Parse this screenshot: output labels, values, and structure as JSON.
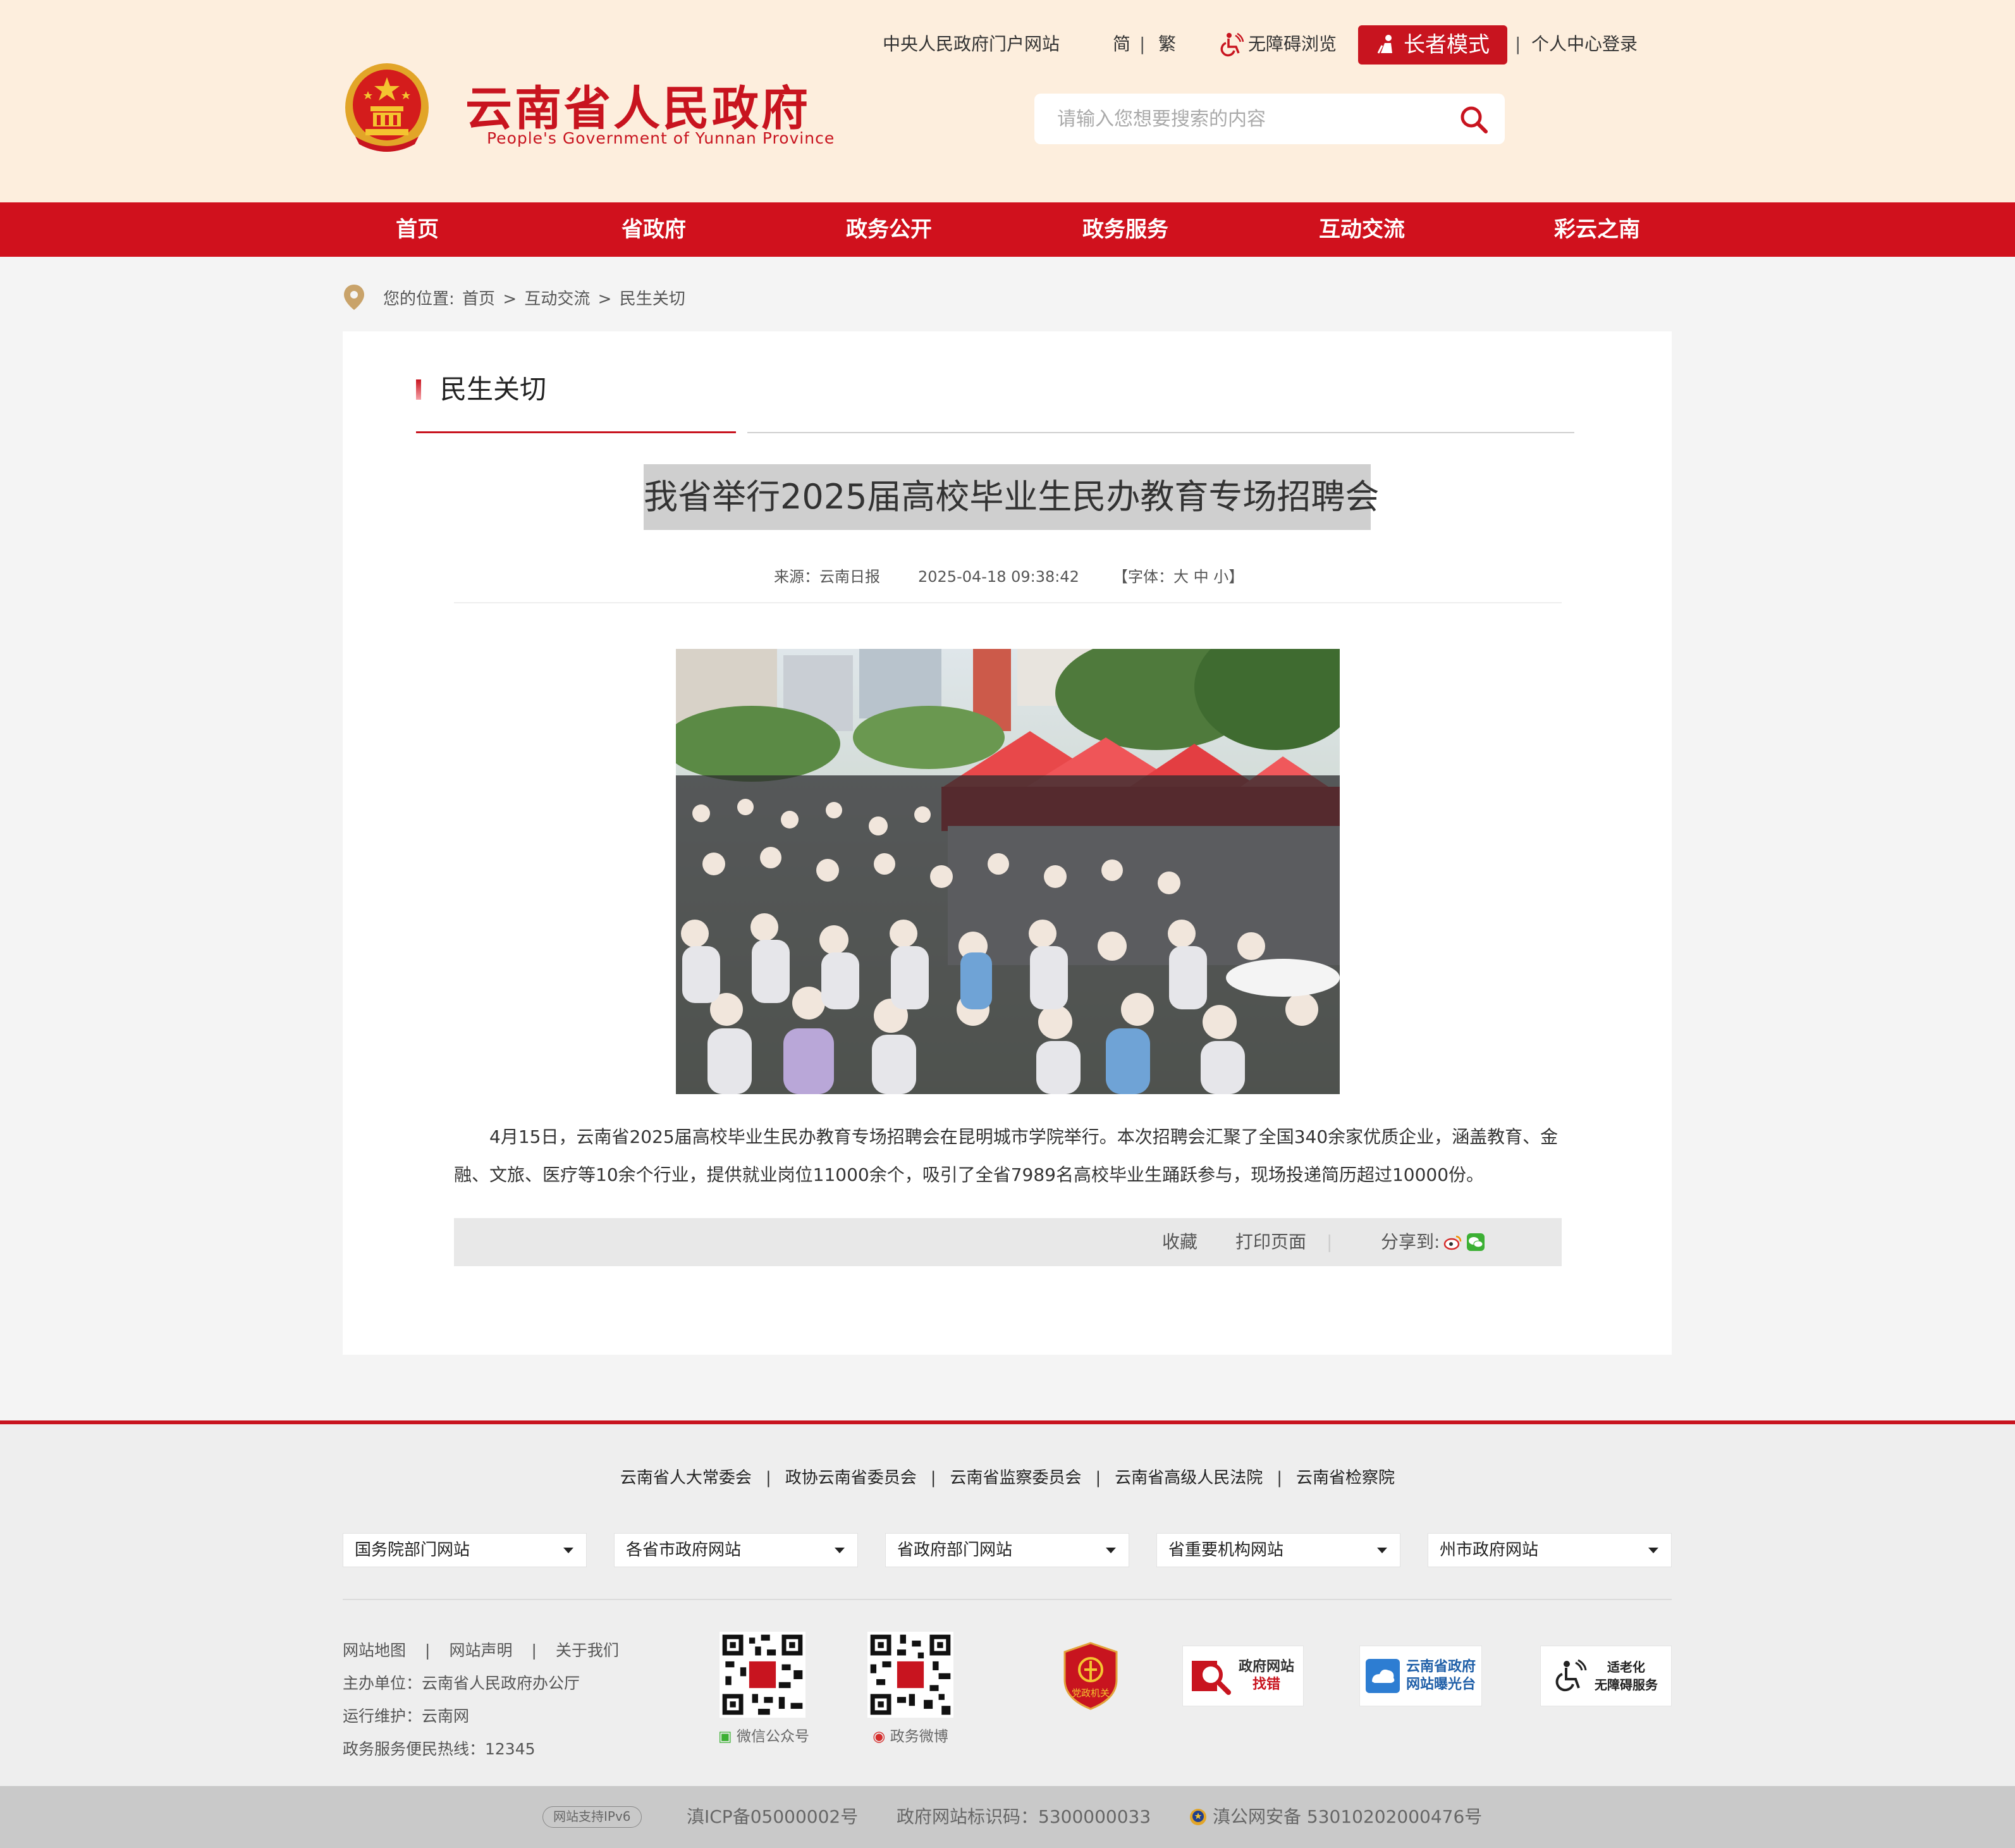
{
  "header": {
    "site_title": "云南省人民政府",
    "site_subtitle": "People's Government of Yunnan Province",
    "top_links": {
      "central_portal": "中央人民政府门户网站",
      "simplified": "简",
      "traditional": "繁",
      "separator": "|",
      "accessible": "无障碍浏览",
      "elder_mode": "长者模式",
      "login": "个人中心登录"
    },
    "search_placeholder": "请输入您想要搜索的内容"
  },
  "nav": {
    "items": [
      "首页",
      "省政府",
      "政务公开",
      "政务服务",
      "互动交流",
      "彩云之南"
    ]
  },
  "breadcrumb": {
    "prefix": "您的位置:",
    "path": [
      "首页",
      "互动交流",
      "民生关切"
    ],
    "separator": ">"
  },
  "section": {
    "title": "民生关切"
  },
  "article": {
    "title": "我省举行2025届高校毕业生民办教育专场招聘会",
    "source": "来源：云南日报",
    "date": "2025-04-18 09:38:42",
    "font_label": "【字体：",
    "font_sizes": [
      "大",
      "中",
      "小"
    ],
    "font_close": "】",
    "body": "4月15日，云南省2025届高校毕业生民办教育专场招聘会在昆明城市学院举行。本次招聘会汇聚了全国340余家优质企业，涵盖教育、金融、文旅、医疗等10余个行业，提供就业岗位11000余个，吸引了全省7989名高校毕业生踊跃参与，现场投递简历超过10000份。"
  },
  "toolbar": {
    "favorite": "收藏",
    "print": "打印页面",
    "share": "分享到:"
  },
  "footer": {
    "org_links": [
      "云南省人大常委会",
      "政协云南省委员会",
      "云南省监察委员会",
      "云南省高级人民法院",
      "云南省检察院"
    ],
    "selects": [
      "国务院部门网站",
      "各省市政府网站",
      "省政府部门网站",
      "省重要机构网站",
      "州市政府网站"
    ],
    "site_links": [
      "网站地图",
      "网站声明",
      "关于我们"
    ],
    "sponsor": "主办单位：云南省人民政府办公厅",
    "maintainer": "运行维护：云南网",
    "hotline": "政务服务便民热线：12345",
    "qr_wechat": "微信公众号",
    "qr_weibo": "政务微博",
    "badges": {
      "party_org": "党政机关",
      "error_report_1": "政府网站",
      "error_report_2": "找错",
      "exposure_1": "云南省政府",
      "exposure_2": "网站曝光台",
      "aging_1": "适老化",
      "aging_2": "无障碍服务"
    }
  },
  "copyright": {
    "ipv6": "网站支持IPv6",
    "icp": "滇ICP备05000002号",
    "site_code": "政府网站标识码：5300000033",
    "police": "滇公网安备 53010202000476号"
  },
  "colors": {
    "brand_red": "#c8141f",
    "nav_red": "#d0111d",
    "header_bg": "#fdeedd"
  }
}
